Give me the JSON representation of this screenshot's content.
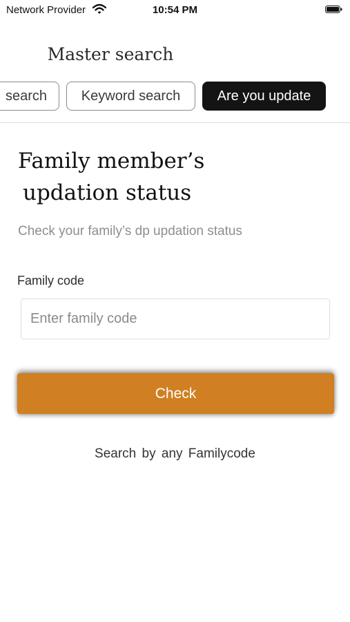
{
  "status_bar": {
    "carrier": "Network Provider",
    "time": "10:54 PM",
    "wifi_icon": "wifi-icon",
    "battery_icon": "battery-icon"
  },
  "header": {
    "title": "Master search",
    "tabs": [
      {
        "label": "search",
        "active": false
      },
      {
        "label": "Keyword search",
        "active": false
      },
      {
        "label": "Are you update",
        "active": true
      }
    ]
  },
  "main": {
    "heading_line1": "Family member’s",
    "heading_line2": "updation status",
    "subtitle": "Check your family’s dp updation status",
    "field_label": "Family code",
    "field_placeholder": "Enter family code",
    "field_value": "",
    "button_label": "Check",
    "hint": "Search by any Familycode"
  },
  "colors": {
    "accent": "#d08022",
    "active_tab": "#141414",
    "background": "#ffffff"
  }
}
